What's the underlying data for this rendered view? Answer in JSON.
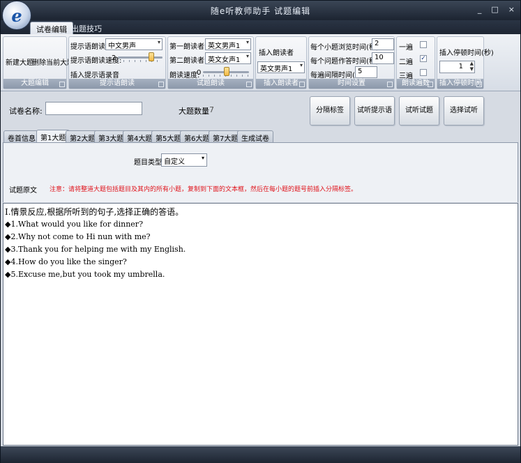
{
  "app": {
    "title": "随e听教师助手  试题编辑",
    "logo_letter": "e"
  },
  "window_buttons": {
    "minimize": "_",
    "maximize": "□",
    "close": "×"
  },
  "ribbon_tabs": [
    "试卷编辑",
    "出题技巧"
  ],
  "groups": {
    "major": {
      "label": "大题编辑",
      "new_btn": "新建大题",
      "del_btn": "删除当前大题"
    },
    "prompt": {
      "label": "提示语朗读",
      "reader_label": "提示语朗读者:",
      "reader_value": "中文男声",
      "speed_label": "提示语朗读速度:",
      "speed_value": "2",
      "speed_level": 0.75,
      "insert_label": "插入提示语录音"
    },
    "reading": {
      "label": "试题朗读",
      "first_label": "第一朗读者:",
      "first_value": "英文男声1",
      "second_label": "第二朗读者:",
      "second_value": "英文女声1",
      "speed_label": "朗读速度:",
      "speed_value": "0",
      "speed_level": 0.5
    },
    "insert_reader": {
      "label": "插入朗读者",
      "title": "插入朗读者",
      "value": "英文男声1"
    },
    "time": {
      "label": "时间设置",
      "t1_label": "每个小题浏览时间(秒):",
      "t1_value": "2",
      "t2_label": "每个问题作答时间(秒):",
      "t2_value": "10",
      "t3_label": "每遍间隔时间(秒):",
      "t3_value": "5"
    },
    "repeat": {
      "label": "朗读遍数",
      "once": "一遍",
      "twice": "二遍",
      "thrice": "三遍",
      "once_checked": false,
      "twice_checked": true,
      "thrice_checked": false,
      "check_mark": "✓"
    },
    "pause": {
      "label": "插入停顿时间",
      "title": "插入停顿时间(秒)",
      "value": "1",
      "spin_up": "▲",
      "spin_down": "▼"
    }
  },
  "form": {
    "name_label": "试卷名称:",
    "name_value": "",
    "count_label": "大题数量",
    "count_value": "7",
    "buttons": [
      "分隔标签",
      "试听提示语",
      "试听试题",
      "选择试听"
    ]
  },
  "content_tabs": [
    "卷首信息",
    "第1大题",
    "第2大题",
    "第3大题",
    "第4大题",
    "第5大题",
    "第6大题",
    "第7大题",
    "生成试卷"
  ],
  "active_content_tab": 1,
  "panel": {
    "type_label": "题目类型",
    "type_value": "自定义",
    "original_label": "试题原文",
    "note": "注意：请将整道大题包括题目及其内的所有小题，复制到下面的文本框，然后在每小题的题号前插入分隔标签。"
  },
  "text_lines": [
    "Ⅰ.情景反应,根据所听到的句子,选择正确的答语。",
    "◆1.What would you like for dinner?",
    "◆2.Why not come to Hi nun with me?",
    "◆3.Thank you for helping me with my English.",
    "◆4.How do you like the singer?",
    "◆5.Excuse me,but you took my umbrella."
  ]
}
